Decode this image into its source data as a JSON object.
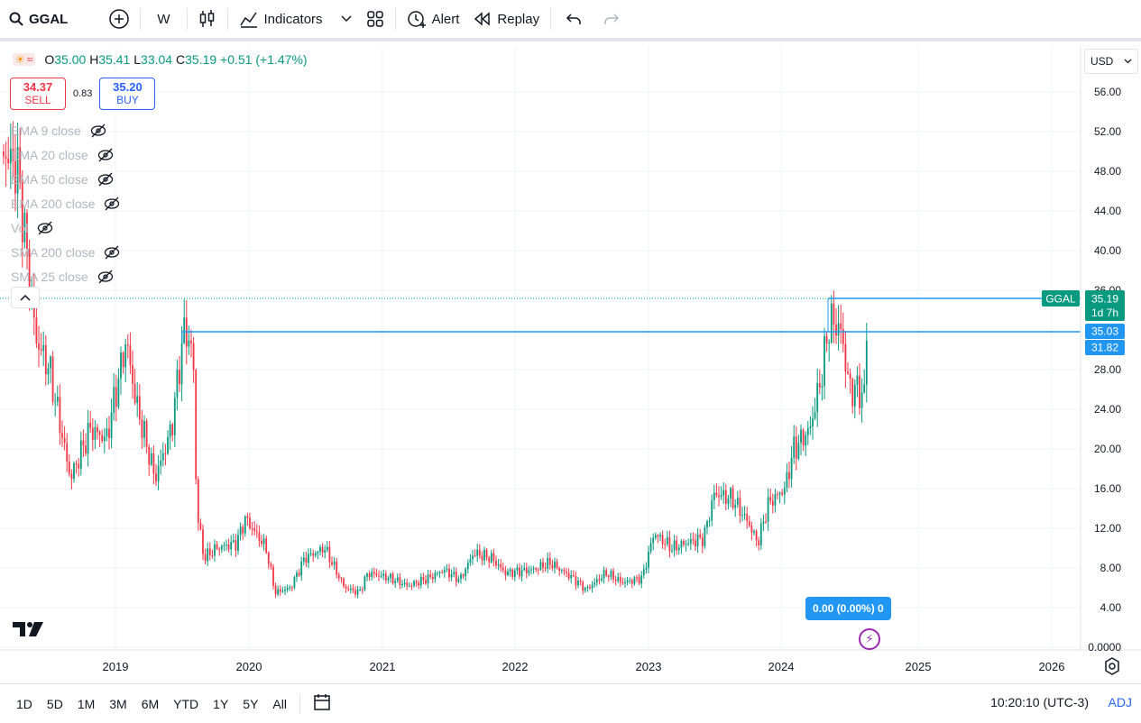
{
  "toolbar": {
    "symbol": "GGAL",
    "interval": "W",
    "indicators_label": "Indicators",
    "alert_label": "Alert",
    "replay_label": "Replay"
  },
  "legend": {
    "open_k": "O",
    "open_v": "35.00",
    "high_k": "H",
    "high_v": "35.41",
    "low_k": "L",
    "low_v": "33.04",
    "close_k": "C",
    "close_v": "35.19",
    "change": "+0.51 (+1.47%)"
  },
  "trade": {
    "sell_price": "34.37",
    "sell_label": "SELL",
    "spread": "0.83",
    "buy_price": "35.20",
    "buy_label": "BUY"
  },
  "indicators": [
    {
      "label": "EMA 9 close"
    },
    {
      "label": "EMA 20 close"
    },
    {
      "label": "EMA 50 close"
    },
    {
      "label": "EMA 200 close"
    },
    {
      "label": "Vol"
    },
    {
      "label": "SMA 200 close"
    },
    {
      "label": "SMA 25 close"
    }
  ],
  "currency": "USD",
  "price_axis": [
    "56.00",
    "52.00",
    "48.00",
    "44.00",
    "40.00",
    "36.00",
    "28.00",
    "24.00",
    "20.00",
    "16.00",
    "12.00",
    "8.00",
    "4.00",
    "0.0000"
  ],
  "price_tags": {
    "symbol_tag": "GGAL",
    "last_price": "35.19",
    "countdown": "1d 7h",
    "line_a": "35.03",
    "line_b": "31.82"
  },
  "measure_pill": "0.00 (0.00%) 0",
  "time_axis": [
    "2019",
    "2020",
    "2021",
    "2022",
    "2023",
    "2024",
    "2025",
    "2026"
  ],
  "ranges": [
    "1D",
    "5D",
    "1M",
    "3M",
    "6M",
    "YTD",
    "1Y",
    "5Y",
    "All"
  ],
  "clock": "10:20:10 (UTC-3)",
  "adj": "ADJ",
  "colors": {
    "up": "#089981",
    "down": "#f23645",
    "line": "#2196f3",
    "accent": "#2962ff"
  },
  "chart_data": {
    "type": "candlestick",
    "x": [
      "2018-04",
      "2018-07",
      "2018-10",
      "2019-01",
      "2019-04",
      "2019-07",
      "2019-08",
      "2019-10",
      "2020-01",
      "2020-04",
      "2020-07",
      "2020-10",
      "2021-01",
      "2021-04",
      "2021-07",
      "2021-10",
      "2022-01",
      "2022-04",
      "2022-07",
      "2022-10",
      "2023-01",
      "2023-04",
      "2023-07",
      "2023-10",
      "2024-01",
      "2024-04",
      "2024-07",
      "2024-08"
    ],
    "close": [
      50,
      30,
      18,
      21,
      30,
      33,
      9,
      10,
      13,
      5,
      10,
      5.5,
      7,
      6.5,
      8,
      9,
      7.5,
      8.5,
      6,
      6.5,
      12,
      10,
      16,
      10,
      16,
      32,
      26,
      35.19
    ],
    "ylim": [
      0,
      58
    ],
    "horizontal_lines": [
      35.03,
      35.19
    ]
  }
}
